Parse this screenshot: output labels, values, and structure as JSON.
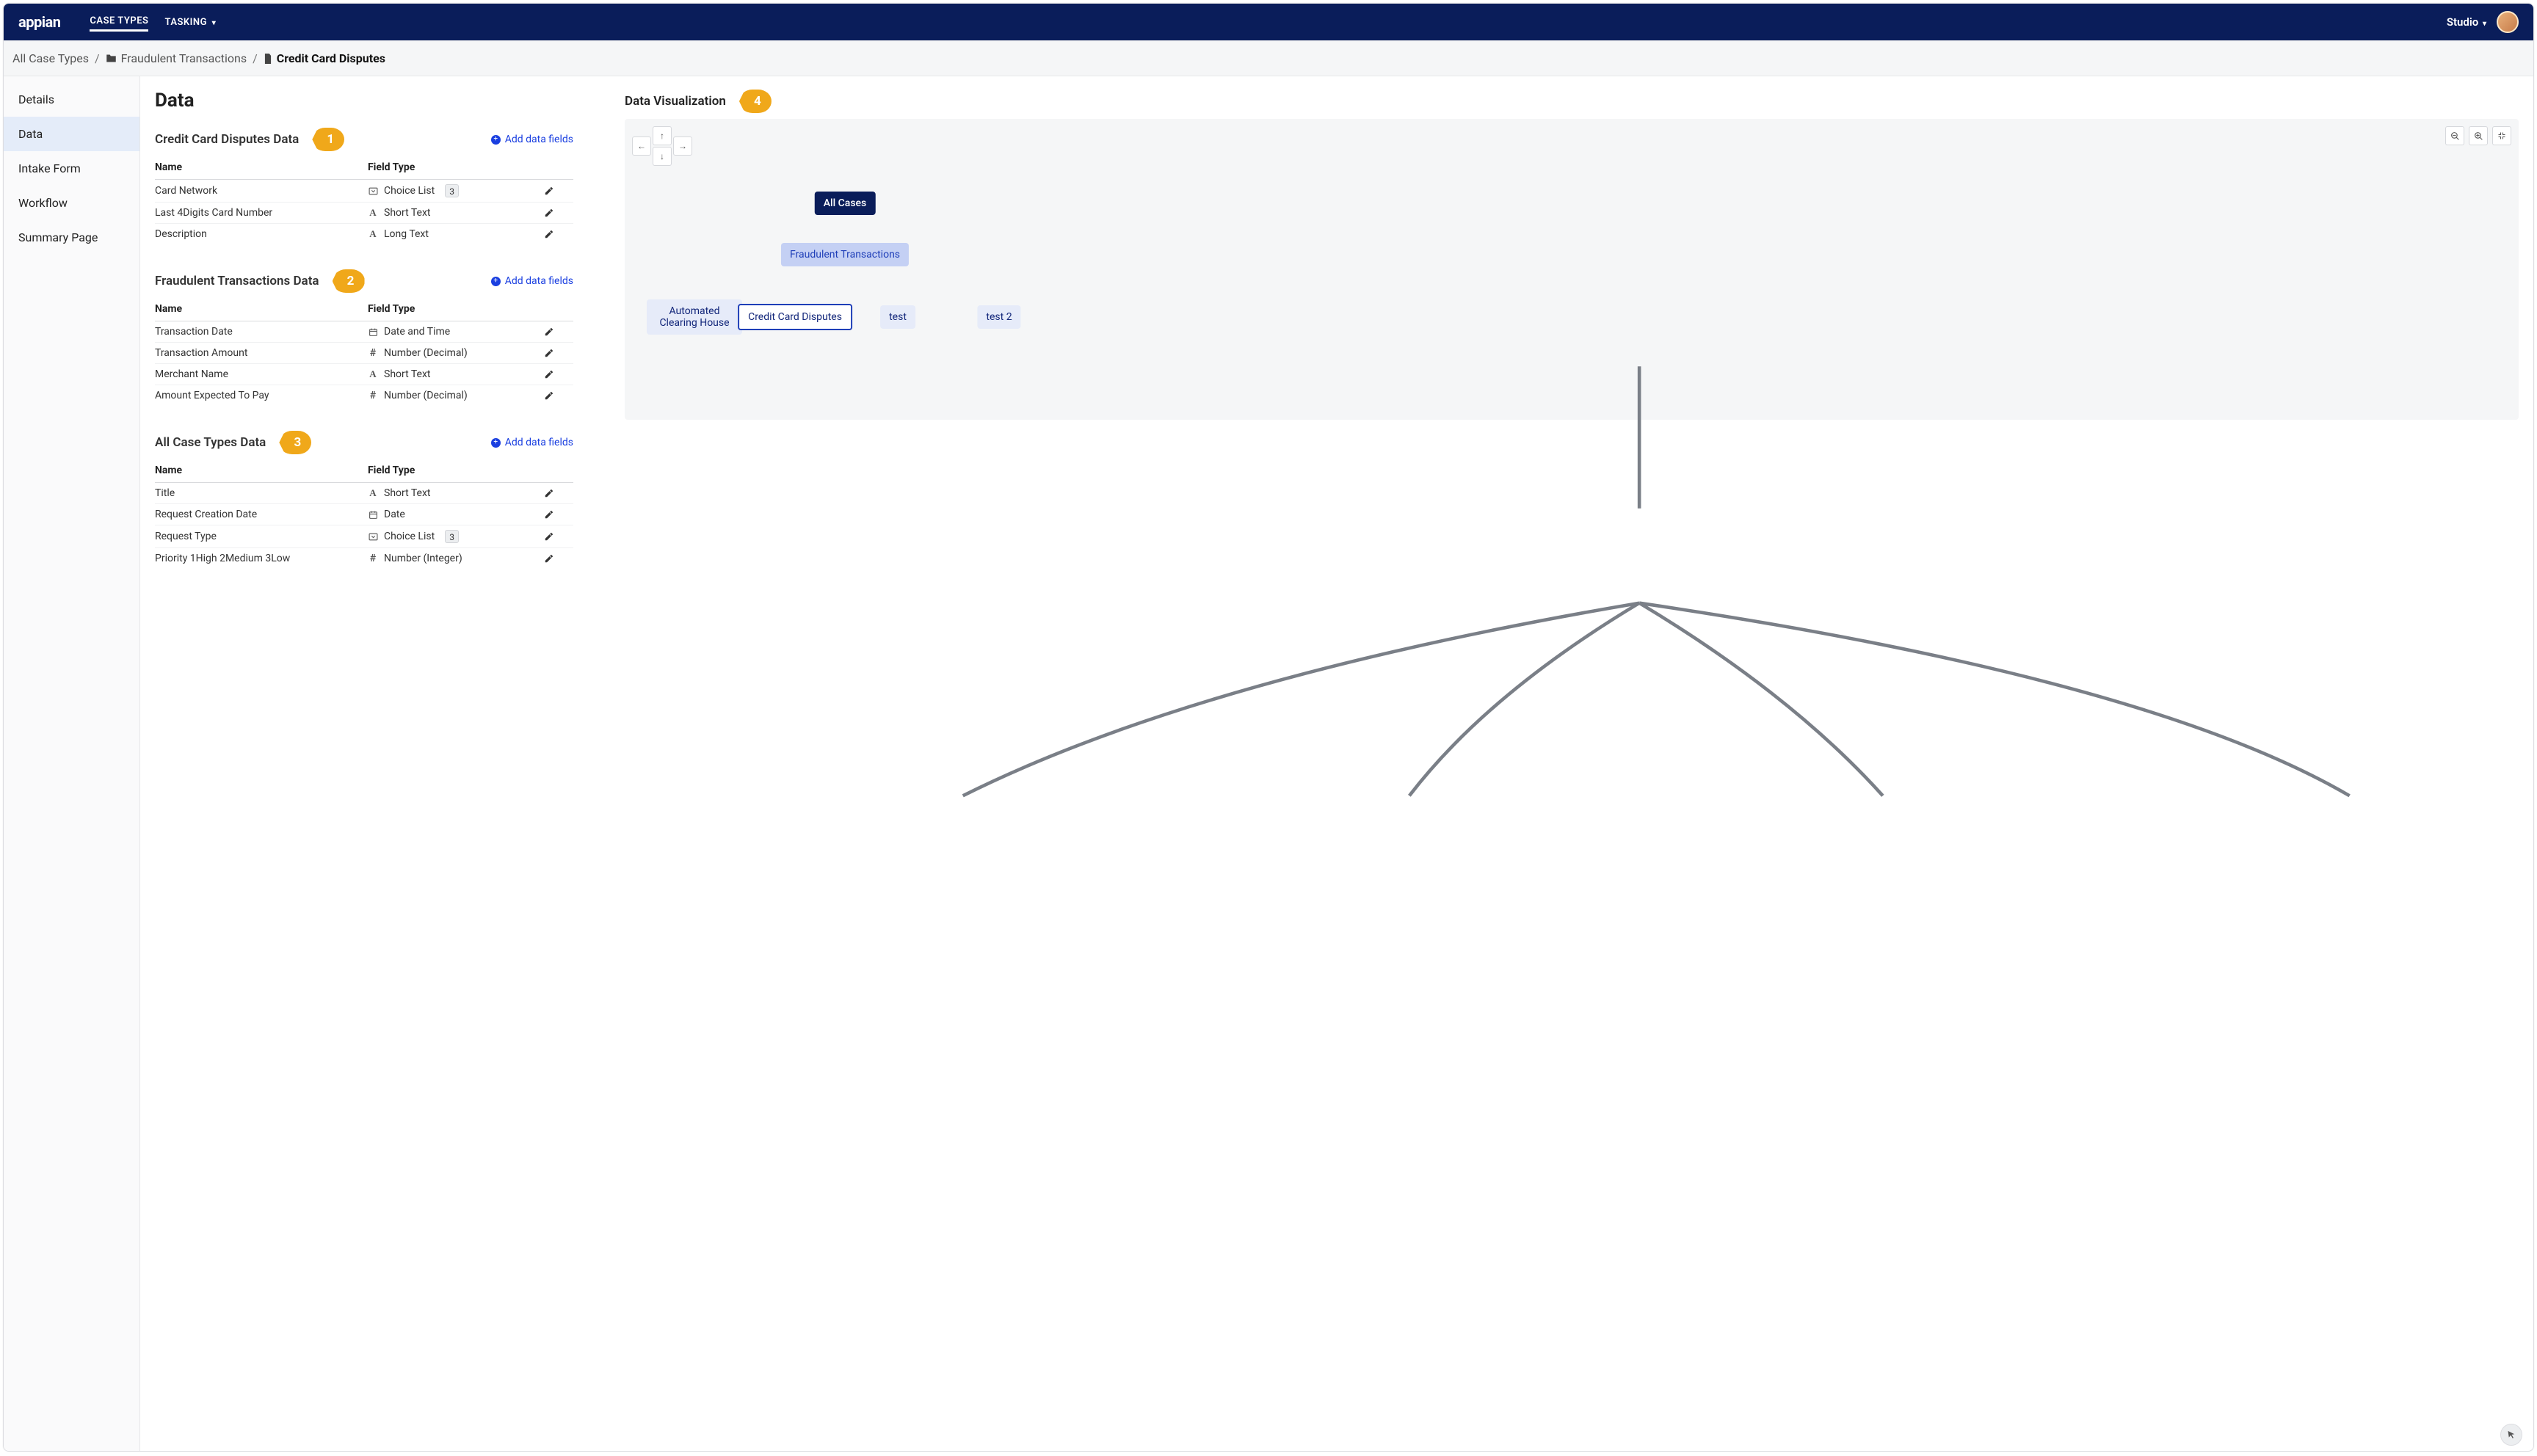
{
  "brand": "appian",
  "nav": {
    "tabs": [
      {
        "label": "CASE TYPES",
        "active": true,
        "dropdown": false
      },
      {
        "label": "TASKING",
        "active": false,
        "dropdown": true
      }
    ],
    "studio": "Studio"
  },
  "breadcrumb": {
    "root": "All Case Types",
    "folder": "Fraudulent Transactions",
    "page": "Credit Card Disputes"
  },
  "sidebar": {
    "items": [
      {
        "label": "Details",
        "active": false
      },
      {
        "label": "Data",
        "active": true
      },
      {
        "label": "Intake Form",
        "active": false
      },
      {
        "label": "Workflow",
        "active": false
      },
      {
        "label": "Summary Page",
        "active": false
      }
    ]
  },
  "page": {
    "title": "Data"
  },
  "labels": {
    "add_data_fields": "Add data fields",
    "col_name": "Name",
    "col_type": "Field Type"
  },
  "callouts": {
    "s1": "1",
    "s2": "2",
    "s3": "3",
    "viz": "4"
  },
  "sections": [
    {
      "title": "Credit Card Disputes Data",
      "fields": [
        {
          "name": "Card Network",
          "type_icon": "choice",
          "type": "Choice List",
          "badge": "3"
        },
        {
          "name": "Last 4Digits Card Number",
          "type_icon": "short",
          "type": "Short Text"
        },
        {
          "name": "Description",
          "type_icon": "long",
          "type": "Long Text"
        }
      ]
    },
    {
      "title": "Fraudulent Transactions Data",
      "fields": [
        {
          "name": "Transaction Date",
          "type_icon": "datetime",
          "type": "Date and Time"
        },
        {
          "name": "Transaction Amount",
          "type_icon": "number",
          "type": "Number (Decimal)"
        },
        {
          "name": "Merchant Name",
          "type_icon": "short",
          "type": "Short Text"
        },
        {
          "name": "Amount Expected To Pay",
          "type_icon": "number",
          "type": "Number (Decimal)"
        }
      ]
    },
    {
      "title": "All Case Types Data",
      "fields": [
        {
          "name": "Title",
          "type_icon": "short",
          "type": "Short Text"
        },
        {
          "name": "Request Creation Date",
          "type_icon": "date",
          "type": "Date"
        },
        {
          "name": "Request Type",
          "type_icon": "choice",
          "type": "Choice List",
          "badge": "3"
        },
        {
          "name": "Priority 1High 2Medium 3Low",
          "type_icon": "int",
          "type": "Number (Integer)"
        }
      ]
    }
  ],
  "viz": {
    "title": "Data Visualization",
    "nodes": {
      "root": "All Cases",
      "mid": "Fraudulent Transactions",
      "leaves": [
        "Automated Clearing House",
        "Credit Card Disputes",
        "test",
        "test 2"
      ],
      "selected_leaf_index": 1
    }
  }
}
